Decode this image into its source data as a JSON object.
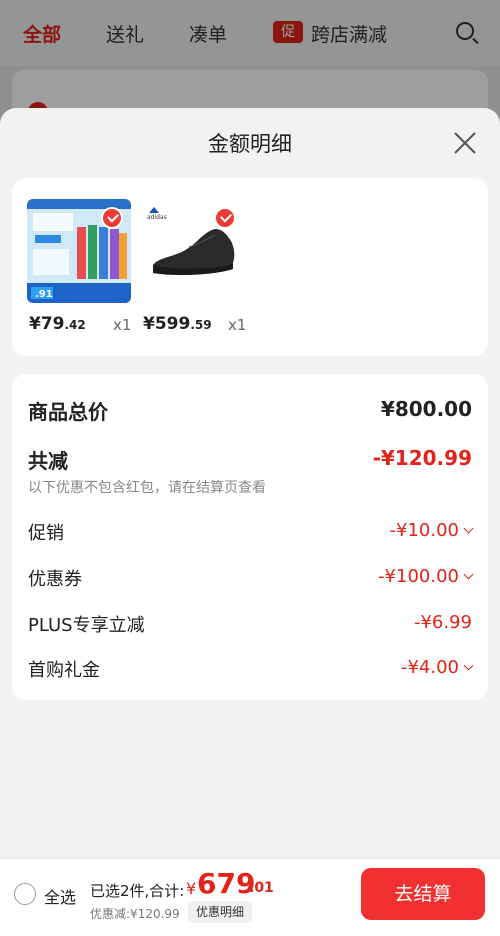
{
  "tabs": [
    {
      "label": "全部",
      "active": true
    },
    {
      "label": "送礼",
      "active": false
    },
    {
      "label": "凑单",
      "active": false
    },
    {
      "label": "跨店满减",
      "active": false,
      "badge": "促"
    }
  ],
  "sheet": {
    "title": "金额明细"
  },
  "products": [
    {
      "price_int": "¥79",
      "price_dec": ".42",
      "qty": "x1",
      "checked": true
    },
    {
      "price_int": "¥599",
      "price_dec": ".59",
      "qty": "x1",
      "checked": true,
      "brand": "adidas"
    }
  ],
  "details": {
    "total_label": "商品总价",
    "total_value": "¥800.00",
    "reduce_label": "共减",
    "reduce_value": "-¥120.99",
    "reduce_note": "以下优惠不包含红包，请在结算页查看",
    "items": [
      {
        "label": "促销",
        "value": "-¥10.00",
        "expandable": true
      },
      {
        "label": "优惠券",
        "value": "-¥100.00",
        "expandable": true
      },
      {
        "label": "PLUS专享立减",
        "value": "-¥6.99",
        "expandable": false
      },
      {
        "label": "首购礼金",
        "value": "-¥4.00",
        "expandable": true
      }
    ]
  },
  "bottom": {
    "select_all": "全选",
    "selected": "已选2件,合计:",
    "total_symbol": "¥",
    "total_int": "679",
    "total_dec": ".01",
    "discount": "优惠减:¥120.99",
    "detail_button": "优惠明细",
    "checkout": "去结算"
  },
  "colors": {
    "accent": "#e2231a",
    "checkout": "#f1312f"
  }
}
